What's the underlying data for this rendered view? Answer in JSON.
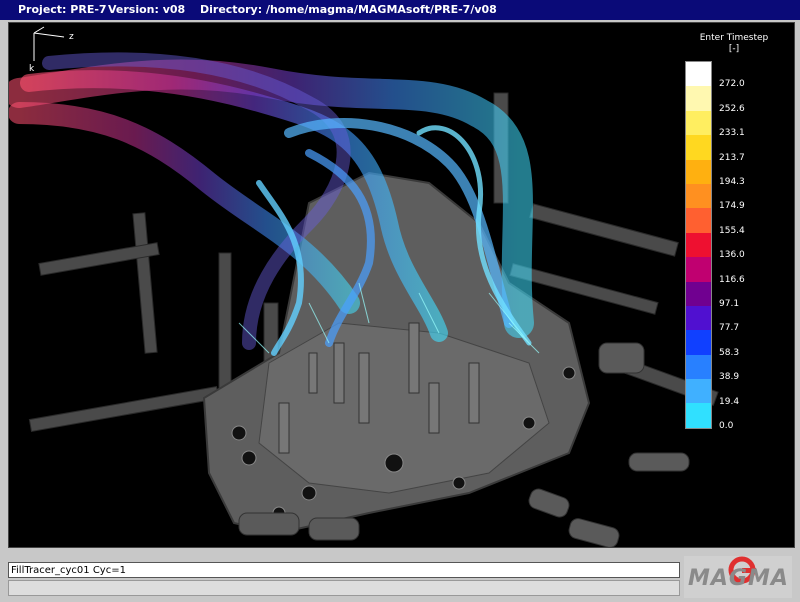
{
  "header": {
    "project": "Project: PRE-7",
    "version": "Version: v08",
    "directory": "Directory: /home/magma/MAGMAsoft/PRE-7/v08"
  },
  "legend": {
    "title_line1": "Enter Timestep",
    "title_line2": "[-]",
    "ticks": [
      "272.0",
      "252.6",
      "233.1",
      "213.7",
      "194.3",
      "174.9",
      "155.4",
      "136.0",
      "116.6",
      "97.1",
      "77.7",
      "58.3",
      "38.9",
      "19.4",
      "0.0"
    ],
    "colors": [
      "#ffffff",
      "#fff8b0",
      "#ffee60",
      "#ffd820",
      "#ffb010",
      "#ff9020",
      "#ff6030",
      "#ee1030",
      "#c00070",
      "#700090",
      "#5010d0",
      "#1040ff",
      "#2880ff",
      "#40b0ff",
      "#30e0ff"
    ]
  },
  "axis": {
    "x_label": "z",
    "y_label": "k"
  },
  "status": {
    "message": "FillTracer_cyc01 Cyc=1"
  },
  "logo": {
    "text": "MAGMA"
  }
}
